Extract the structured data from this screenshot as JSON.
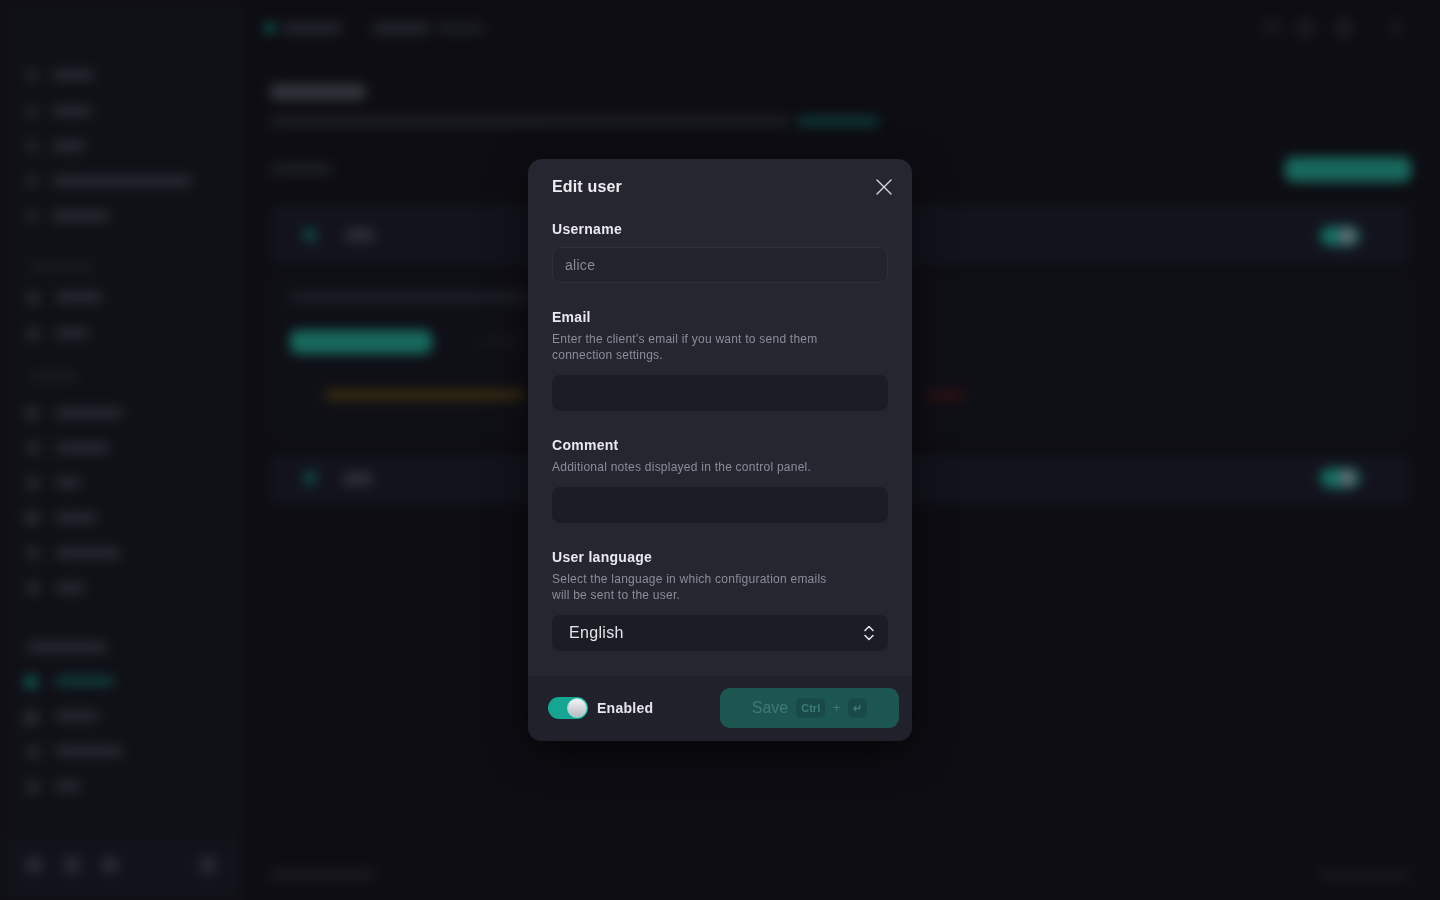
{
  "dialog": {
    "title": "Edit user",
    "fields": [
      {
        "kind": "text",
        "label": "Username",
        "value": "alice",
        "disabled": true
      },
      {
        "kind": "text",
        "label": "Email",
        "description": "Enter the client's email if you want to send them connection settings.",
        "disabled": false
      },
      {
        "kind": "text",
        "label": "Comment",
        "description": "Additional notes displayed in the control panel.",
        "disabled": false
      },
      {
        "kind": "select",
        "label": "User language",
        "description": "Select the language in which configuration emails will be sent to the user.",
        "value": "English",
        "disabled": false
      }
    ],
    "footer": {
      "enabled_toggle": {
        "label": "Enabled",
        "on": true
      },
      "save_button": {
        "label": "Save",
        "disabled": true,
        "shortcut": [
          "Ctrl",
          "+",
          "↵"
        ]
      }
    }
  }
}
